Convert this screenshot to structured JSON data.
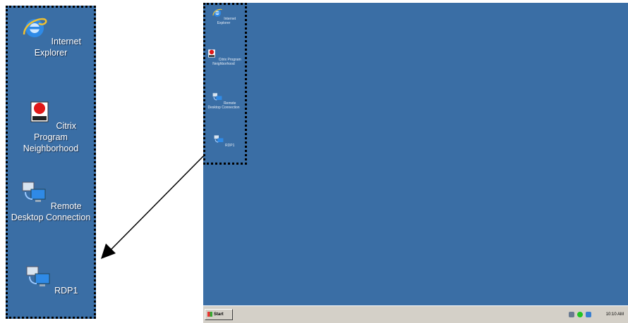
{
  "zoom_icons": [
    {
      "label": "Internet Explorer",
      "icon": "internet-explorer-icon"
    },
    {
      "label": "Citrix Program Neighborhood",
      "icon": "citrix-icon"
    },
    {
      "label": "Remote Desktop Connection",
      "icon": "remote-desktop-icon"
    },
    {
      "label": "RDP1",
      "icon": "remote-desktop-icon"
    }
  ],
  "desktop_icons": [
    {
      "label": "Internet Explorer",
      "icon": "internet-explorer-icon"
    },
    {
      "label": "Citrix Program Neighborhood",
      "icon": "citrix-icon"
    },
    {
      "label": "Remote Desktop Connection",
      "icon": "remote-desktop-icon"
    },
    {
      "label": "RDP1",
      "icon": "remote-desktop-icon"
    }
  ],
  "taskbar": {
    "start_label": "Start",
    "clock": "10:10 AM"
  },
  "colors": {
    "desktop": "#3a6ea5",
    "taskbar": "#d4d0c8"
  }
}
